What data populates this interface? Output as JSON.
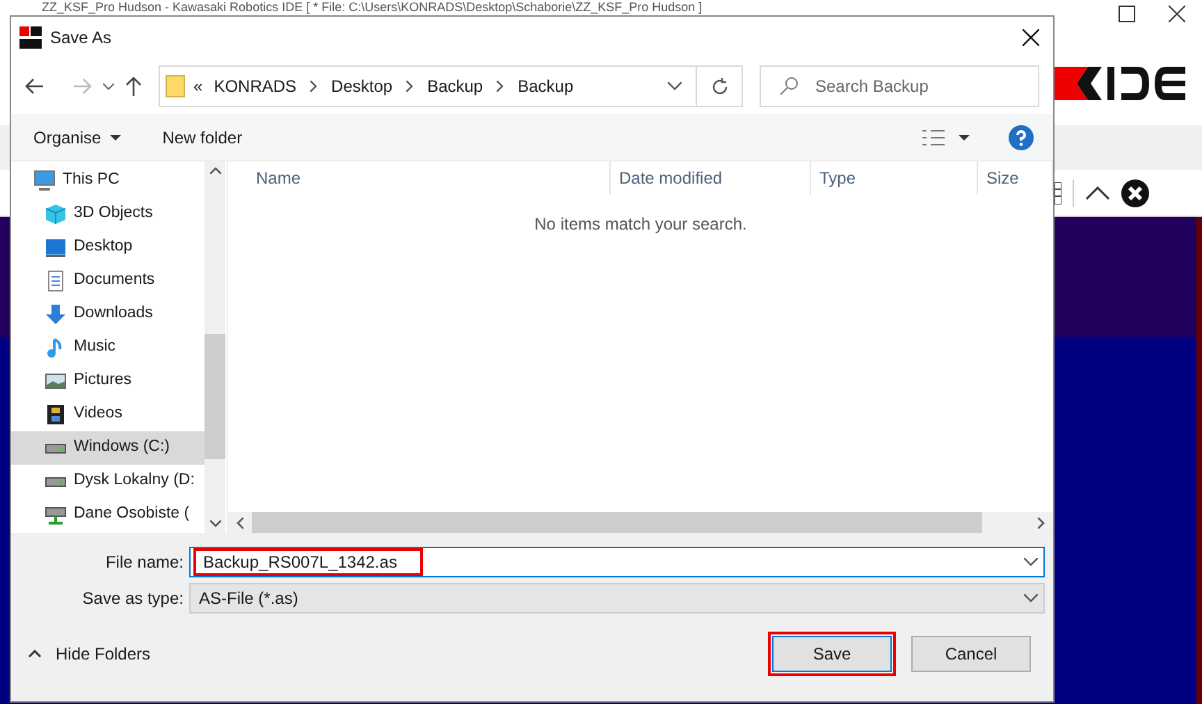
{
  "background_window": {
    "title": "ZZ_KSF_Pro Hudson - Kawasaki Robotics IDE [ * File: C:\\Users\\KONRADS\\Desktop\\Schaborie\\ZZ_KSF_Pro Hudson ]"
  },
  "dialog": {
    "title": "Save As",
    "address": {
      "prefix": "«",
      "crumbs": [
        "KONRADS",
        "Desktop",
        "Backup",
        "Backup"
      ]
    },
    "search": {
      "placeholder": "Search Backup"
    },
    "toolbar": {
      "organise": "Organise",
      "new_folder": "New folder"
    },
    "sidebar": {
      "items": [
        {
          "label": "This PC",
          "selected": false,
          "children": [
            {
              "label": "3D Objects",
              "selected": false
            },
            {
              "label": "Desktop",
              "selected": false
            },
            {
              "label": "Documents",
              "selected": false
            },
            {
              "label": "Downloads",
              "selected": false
            },
            {
              "label": "Music",
              "selected": false
            },
            {
              "label": "Pictures",
              "selected": false
            },
            {
              "label": "Videos",
              "selected": false
            },
            {
              "label": "Windows (C:)",
              "selected": true
            },
            {
              "label": "Dysk Lokalny (D:",
              "selected": false
            },
            {
              "label": "Dane Osobiste (",
              "selected": false
            }
          ]
        }
      ]
    },
    "columns": [
      "Name",
      "Date modified",
      "Type",
      "Size"
    ],
    "empty_message": "No items match your search.",
    "file_name": {
      "label": "File name:",
      "value": "Backup_RS007L_1342.as"
    },
    "save_as_type": {
      "label": "Save as type:",
      "value": "AS-File (*.as)"
    },
    "hide_folders": "Hide Folders",
    "buttons": [
      {
        "label": "Save",
        "highlighted": true
      },
      {
        "label": "Cancel",
        "highlighted": false
      }
    ]
  }
}
